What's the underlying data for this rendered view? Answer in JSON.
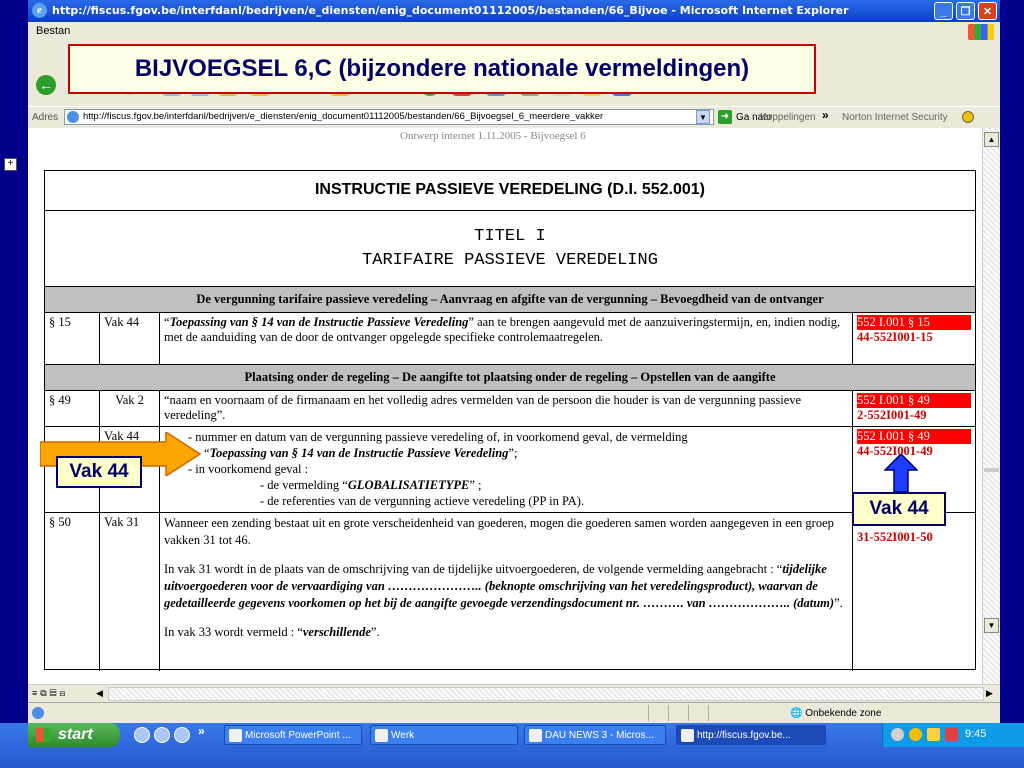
{
  "window": {
    "title": "http://fiscus.fgov.be/interfdanl/bedrijven/e_diensten/enig_document01112005/bestanden/66_Bijvoe - Microsoft Internet Explorer",
    "menu_text": "Bestan"
  },
  "address": {
    "label": "Adres",
    "url": "http://fiscus.fgov.be/interfdanl/bedrijven/e_diensten/enig_document01112005/bestanden/66_Bijvoegsel_6_meerdere_vakker",
    "go_label": "Ga naar",
    "links_label": "Koppelingen",
    "chevron": "»",
    "norton_label": "Norton Internet Security"
  },
  "slide": {
    "title": "BIJVOEGSEL 6,C (bijzondere nationale vermeldingen)",
    "vak44_left": "Vak 44",
    "vak44_right": "Vak 44"
  },
  "document": {
    "ghost_header": "Ontwerp internet 1.11.2005 - Bijvoegsel 6",
    "instruction_title": "INSTRUCTIE PASSIEVE VEREDELING (D.I. 552.001)",
    "titel_line1": "TITEL I",
    "titel_line2": "TARIFAIRE PASSIEVE VEREDELING",
    "section1_header": "De vergunning tarifaire passieve veredeling – Aanvraag en afgifte van de vergunning – Bevoegdheid van de ontvanger",
    "section2_header": "Plaatsing onder de regeling – De aangifte tot plaatsing onder de regeling – Opstellen van de aangifte",
    "rows": [
      {
        "par": "§ 15",
        "vak": "Vak 44",
        "text_a": "“",
        "text_b": "Toepassing van § 14 van de Instructie Passieve Veredeling",
        "text_c": "” aan te brengen aangevuld met de aanzuiveringstermijn, en, indien nodig, met de aanduiding van de door de ontvanger opgelegde specifieke controlemaatregelen.",
        "code1": "552 I.001 § 15",
        "code2": "44-552I001-15"
      },
      {
        "par": "§ 49",
        "vak": "Vak 2",
        "text": "“naam en voornaam of de firmanaam en het volledig adres vermelden van de persoon die houder is van de vergunning passieve veredeling”.",
        "code1": "552 I.001 § 49",
        "code2": "2-552I001-49"
      },
      {
        "vak": "Vak 44",
        "line1": "-    nummer en datum van de vergunning passieve veredeling of, in voorkomend geval, de vermelding",
        "line2_a": "“",
        "line2_b": "Toepassing van § 14 van de Instructie Passieve Veredeling",
        "line2_c": "”;",
        "line3": "-    in voorkomend geval :",
        "line4_a": "- de vermelding “",
        "line4_b": "GLOBALISATIETYPE",
        "line4_c": "” ;",
        "line5": "- de referenties van de vergunning actieve veredeling (PP in PA).",
        "code1": "552 I.001 § 49",
        "code2": "44-552I001-49"
      },
      {
        "par": "§ 50",
        "vak": "Vak 31",
        "p1": "Wanneer een zending bestaat uit en grote verscheidenheid van goederen, mogen die goederen samen worden aangegeven in een groep vakken 31 tot 46.",
        "p2_a": "In vak 31 wordt in de plaats van de omschrijving van de tijdelijke uitvoergoederen, de volgende vermelding aangebracht : “",
        "p2_b": "tijdelijke uitvoergoederen voor de vervaardiging van ………………….. (beknopte omschrijving van het veredelingsproduct), waarvan de gedetailleerde gegevens voorkomen op het bij de aangifte gevoegde verzendingsdocument nr. ………. van ……………….. (datum)",
        "p2_c": "”.",
        "p3_a": "In vak 33 wordt vermeld : “",
        "p3_b": "verschillende",
        "p3_c": "”.",
        "code2": "31-552I001-50"
      }
    ]
  },
  "statusbar": {
    "zone": "Onbekende zone"
  },
  "taskbar": {
    "start": "start",
    "chevron": "»",
    "items": [
      "Microsoft PowerPoint ...",
      "Werk",
      "DAU NEWS 3 - Micros...",
      "http://fiscus.fgov.be..."
    ],
    "clock": "9:45"
  },
  "colors": {
    "accent": "#d00000",
    "highlight": "#ff0000",
    "slide_text": "#000066",
    "arrow": "#ffa500"
  }
}
